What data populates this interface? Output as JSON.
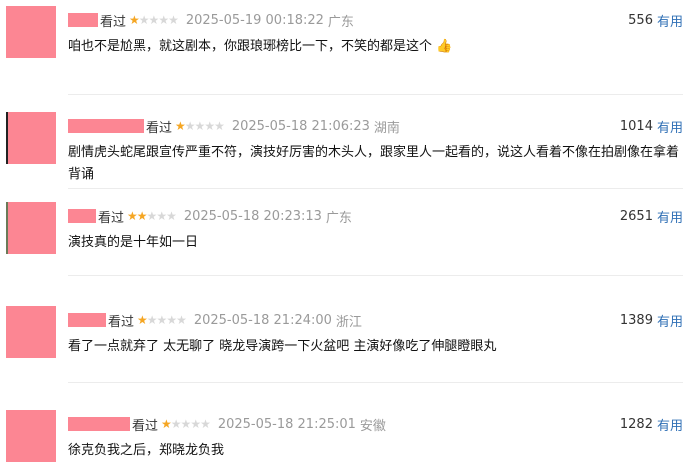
{
  "theme": {
    "avatar_pink": "#fc8693",
    "star_on": "#f5a623",
    "star_off": "#d8d8d8",
    "link_blue": "#2f6fb5"
  },
  "comments": [
    {
      "status": "看过",
      "rating": 1,
      "time": "2025-05-19 00:18:22",
      "location": "广东",
      "votes": "556",
      "useful_label": "有用",
      "text": "咱也不是尬黑，就这剧本，你跟琅琊榜比一下，不笑的都是这个",
      "emoji_icon": "thumbs-up-icon"
    },
    {
      "status": "看过",
      "rating": 1,
      "time": "2025-05-18 21:06:23",
      "location": "湖南",
      "votes": "1014",
      "useful_label": "有用",
      "text": "剧情虎头蛇尾跟宣传严重不符，演技好厉害的木头人，跟家里人一起看的，说这人看着不像在拍剧像在拿着背诵"
    },
    {
      "status": "看过",
      "rating": 2,
      "time": "2025-05-18 20:23:13",
      "location": "广东",
      "votes": "2651",
      "useful_label": "有用",
      "text": "演技真的是十年如一日"
    },
    {
      "status": "看过",
      "rating": 1,
      "time": "2025-05-18 21:24:00",
      "location": "浙江",
      "votes": "1389",
      "useful_label": "有用",
      "text": "看了一点就弃了 太无聊了 晓龙导演跨一下火盆吧 主演好像吃了伸腿瞪眼丸"
    },
    {
      "status": "看过",
      "rating": 1,
      "time": "2025-05-18 21:25:01",
      "location": "安徽",
      "votes": "1282",
      "useful_label": "有用",
      "text": "徐克负我之后，郑晓龙负我"
    }
  ]
}
